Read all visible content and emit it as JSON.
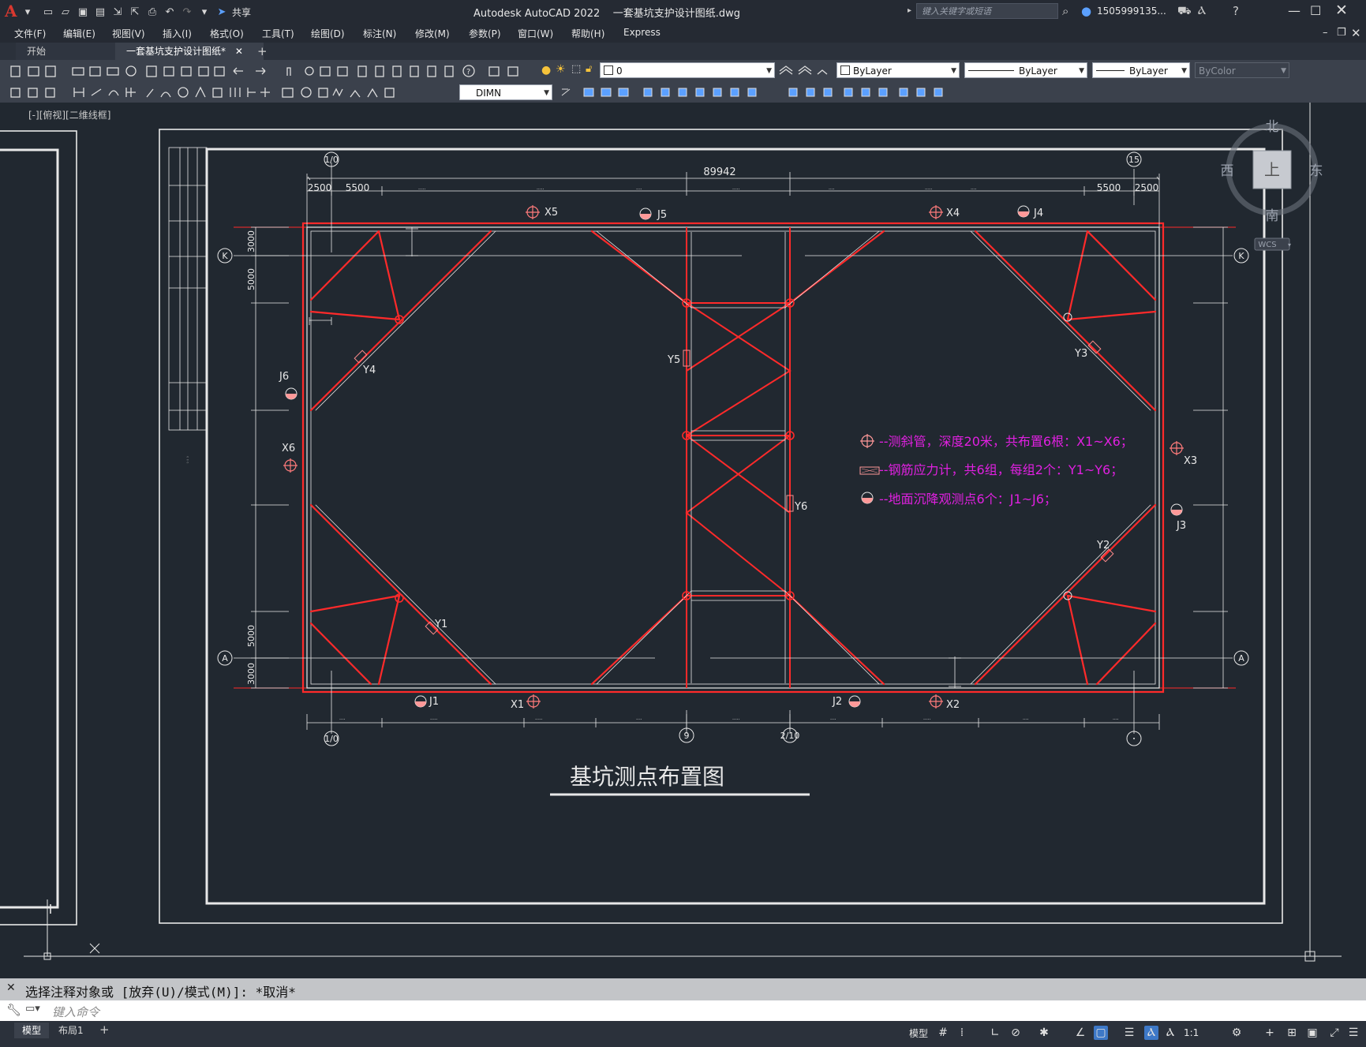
{
  "app": {
    "title": "Autodesk AutoCAD 2022",
    "file": "一套基坑支护设计图纸.dwg",
    "share": "共享",
    "search_placeholder": "键入关键字或短语",
    "user": "1505999135...",
    "brand_color": "#d9382f"
  },
  "menu": [
    "文件(F)",
    "编辑(E)",
    "视图(V)",
    "插入(I)",
    "格式(O)",
    "工具(T)",
    "绘图(D)",
    "标注(N)",
    "修改(M)",
    "参数(P)",
    "窗口(W)",
    "帮助(H)",
    "Express"
  ],
  "tabs": [
    {
      "label": "开始",
      "active": false
    },
    {
      "label": "一套基坑支护设计图纸*",
      "active": true
    }
  ],
  "toolbar": {
    "layer": "0",
    "color": "ByLayer",
    "linetype": "ByLayer",
    "lineweight": "ByLayer",
    "plotstyle": "ByColor",
    "dimstyle": "DIMN"
  },
  "viewport": {
    "label": "[-][俯视][二维线框]"
  },
  "viewcube": {
    "north": "北",
    "south": "南",
    "east": "东",
    "west": "西",
    "top": "上",
    "wcs": "WCS"
  },
  "drawing": {
    "title": "基坑测点布置图",
    "overall_dim": "89942",
    "top_dims": [
      "2500",
      "5500",
      "5500",
      "2500"
    ],
    "left_dims": [
      "3000",
      "5000",
      "5000",
      "3000"
    ],
    "axis_top": [
      "1/0",
      "15"
    ],
    "axis_bottom": [
      "1/0",
      "9",
      "2/10"
    ],
    "axis_side": [
      "K",
      "A"
    ],
    "points": [
      "X5",
      "J5",
      "X4",
      "J4",
      "Y4",
      "Y5",
      "Y3",
      "J6",
      "X6",
      "Y6",
      "X3",
      "J3",
      "Y2",
      "Y1",
      "J1",
      "X1",
      "J2",
      "X2"
    ],
    "legend": [
      "--测斜管，深度20米，共布置6根：X1~X6；",
      "--钢筋应力计，共6组，每组2个：Y1~Y6；",
      "--地面沉降观测点6个：J1~J6；"
    ],
    "legend_color": "#e020e0",
    "line_color": "#ff2a2a"
  },
  "command": {
    "history": "选择注释对象或 [放弃(U)/模式(M)]: *取消*",
    "placeholder": "键入命令"
  },
  "status": {
    "tabs": [
      "模型",
      "布局1"
    ],
    "model_label": "模型",
    "scale": "1:1"
  }
}
